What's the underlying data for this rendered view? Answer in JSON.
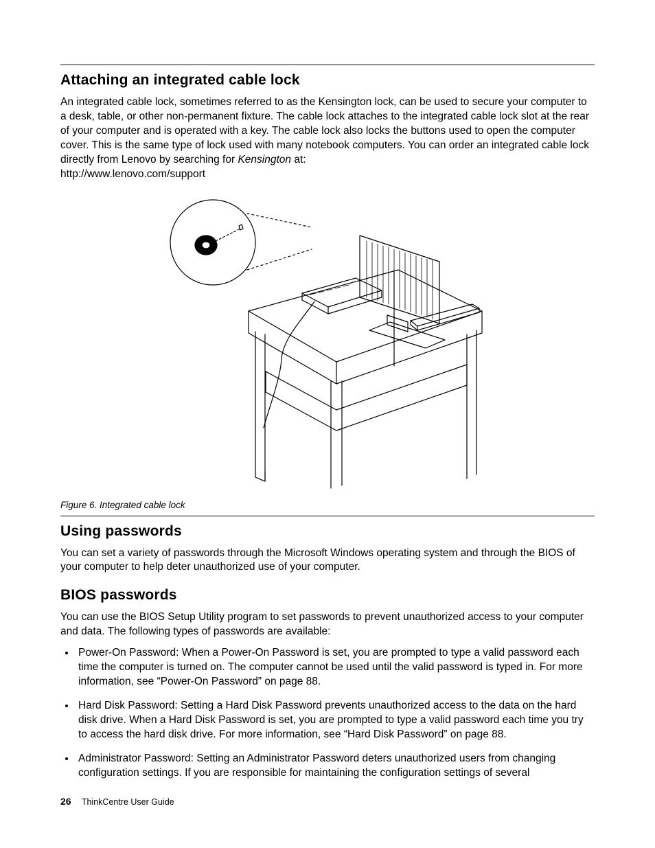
{
  "section1": {
    "title": "Attaching an integrated cable lock",
    "para_a": "An integrated cable lock, sometimes referred to as the Kensington lock, can be used to secure your computer to a desk, table, or other non-permanent fixture. The cable lock attaches to the integrated cable lock slot at the rear of your computer and is operated with a key. The cable lock also locks the buttons used to open the computer cover. This is the same type of lock used with many notebook computers. You can order an integrated cable lock directly from Lenovo by searching for ",
    "para_a_em": "Kensington",
    "para_a_tail": " at:",
    "para_b": "http://www.lenovo.com/support"
  },
  "figure": {
    "caption": "Figure 6.  Integrated cable lock"
  },
  "section2": {
    "title": "Using passwords",
    "para": "You can set a variety of passwords through the Microsoft Windows operating system and through the BIOS of your computer to help deter unauthorized use of your computer."
  },
  "section3": {
    "title": "BIOS passwords",
    "para": "You can use the BIOS Setup Utility program to set passwords to prevent unauthorized access to your computer and data. The following types of passwords are available:",
    "bullets": [
      "Power-On Password: When a Power-On Password is set, you are prompted to type a valid password each time the computer is turned on. The computer cannot be used until the valid password is typed in. For more information, see “Power-On Password” on page 88.",
      "Hard Disk Password: Setting a Hard Disk Password prevents unauthorized access to the data on the hard disk drive. When a Hard Disk Password is set, you are prompted to type a valid password each time you try to access the hard disk drive. For more information, see “Hard Disk Password” on page 88.",
      "Administrator Password: Setting an Administrator Password deters unauthorized users from changing configuration settings. If you are responsible for maintaining the configuration settings of several"
    ]
  },
  "footer": {
    "page": "26",
    "book": "ThinkCentre User Guide"
  }
}
